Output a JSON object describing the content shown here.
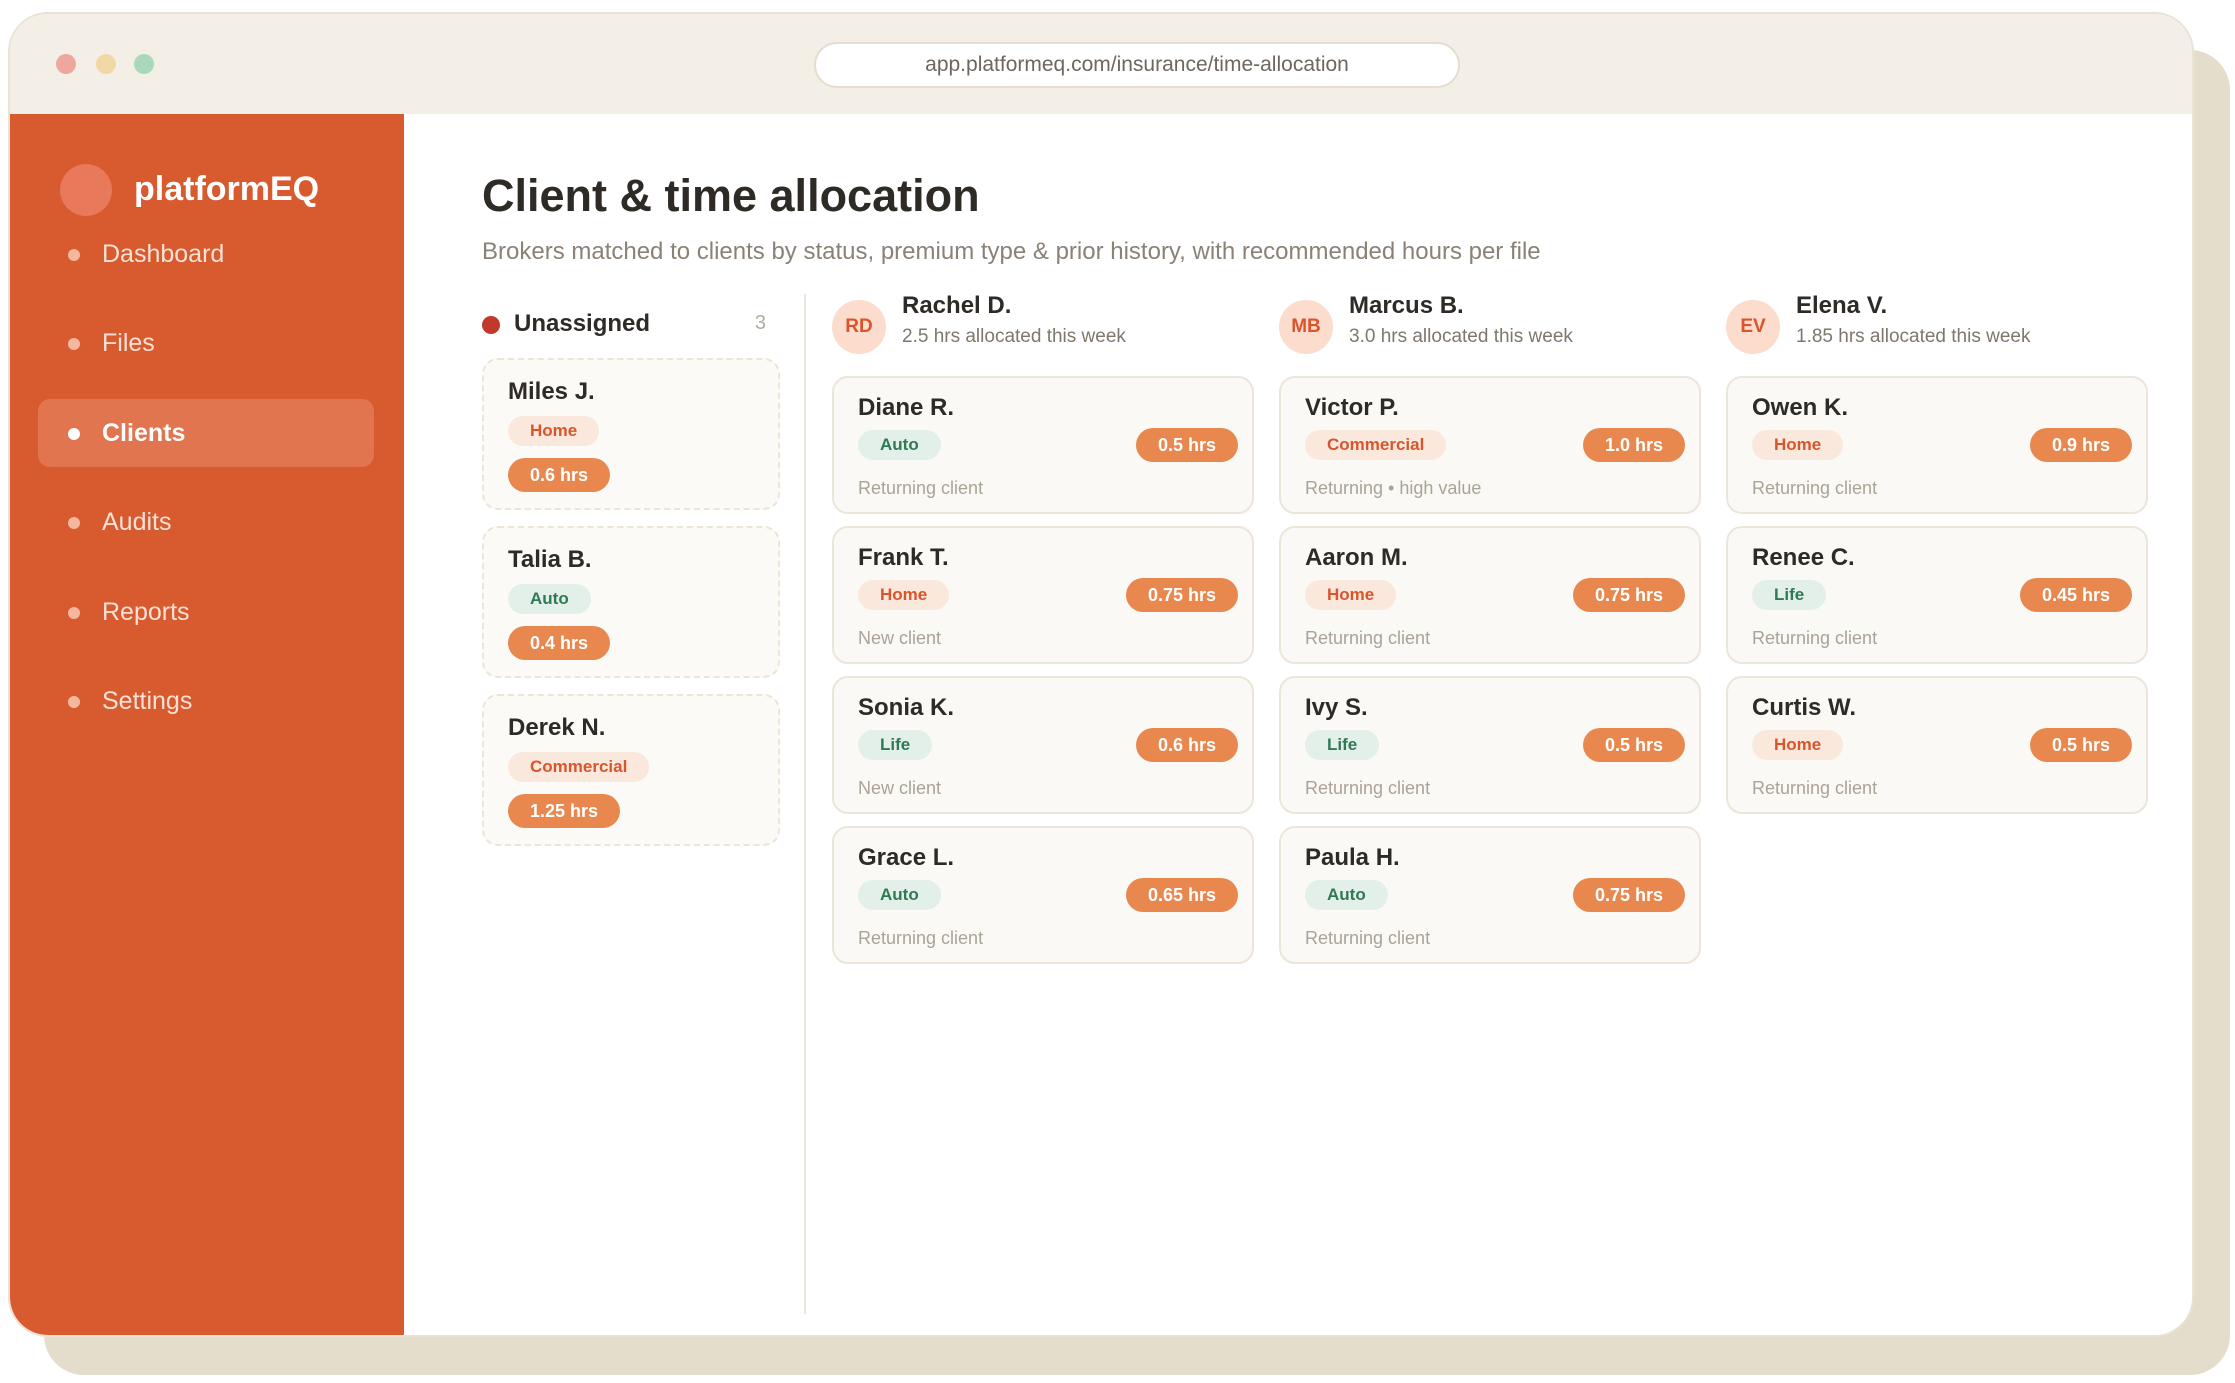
{
  "browser": {
    "url": "app.platformeq.com/insurance/time-allocation"
  },
  "sidebar": {
    "brand": "platformEQ",
    "items": [
      {
        "label": "Dashboard",
        "active": false
      },
      {
        "label": "Files",
        "active": false
      },
      {
        "label": "Clients",
        "active": true
      },
      {
        "label": "Audits",
        "active": false
      },
      {
        "label": "Reports",
        "active": false
      },
      {
        "label": "Settings",
        "active": false
      }
    ]
  },
  "page": {
    "title": "Client & time allocation",
    "subtitle": "Brokers matched to clients by status, premium type & prior history, with recommended hours per file"
  },
  "unassigned": {
    "label": "Unassigned",
    "count": "3",
    "cards": [
      {
        "name": "Miles J.",
        "type": "Home",
        "hrs": "0.6 hrs"
      },
      {
        "name": "Talia B.",
        "type": "Auto",
        "hrs": "0.4 hrs"
      },
      {
        "name": "Derek N.",
        "type": "Commercial",
        "hrs": "1.25 hrs"
      }
    ]
  },
  "brokers": [
    {
      "initials": "RD",
      "name": "Rachel D.",
      "allocated": "2.5 hrs allocated this week",
      "clients": [
        {
          "name": "Diane R.",
          "type": "Auto",
          "hrs": "0.5 hrs",
          "status": "Returning client"
        },
        {
          "name": "Frank T.",
          "type": "Home",
          "hrs": "0.75 hrs",
          "status": "New client"
        },
        {
          "name": "Sonia K.",
          "type": "Life",
          "hrs": "0.6 hrs",
          "status": "New client"
        },
        {
          "name": "Grace L.",
          "type": "Auto",
          "hrs": "0.65 hrs",
          "status": "Returning client"
        }
      ]
    },
    {
      "initials": "MB",
      "name": "Marcus B.",
      "allocated": "3.0 hrs allocated this week",
      "clients": [
        {
          "name": "Victor P.",
          "type": "Commercial",
          "hrs": "1.0 hrs",
          "status": "Returning • high value"
        },
        {
          "name": "Aaron M.",
          "type": "Home",
          "hrs": "0.75 hrs",
          "status": "Returning client"
        },
        {
          "name": "Ivy S.",
          "type": "Life",
          "hrs": "0.5 hrs",
          "status": "Returning client"
        },
        {
          "name": "Paula H.",
          "type": "Auto",
          "hrs": "0.75 hrs",
          "status": "Returning client"
        }
      ]
    },
    {
      "initials": "EV",
      "name": "Elena V.",
      "allocated": "1.85 hrs allocated this week",
      "clients": [
        {
          "name": "Owen K.",
          "type": "Home",
          "hrs": "0.9 hrs",
          "status": "Returning client"
        },
        {
          "name": "Renee C.",
          "type": "Life",
          "hrs": "0.45 hrs",
          "status": "Returning client"
        },
        {
          "name": "Curtis W.",
          "type": "Home",
          "hrs": "0.5 hrs",
          "status": "Returning client"
        }
      ]
    }
  ],
  "colors": {
    "sidebar": "#d85a2f",
    "accent": "#e8884f",
    "tag_warm": "#d9552b",
    "tag_cool": "#2f7a55",
    "unassigned_dot": "#c0392b"
  }
}
